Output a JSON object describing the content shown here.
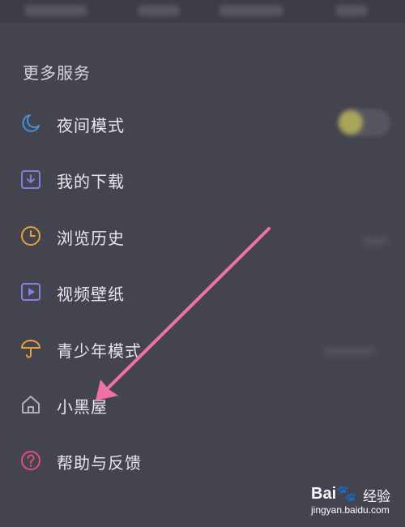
{
  "section": {
    "title": "更多服务"
  },
  "menu": [
    {
      "label": "夜间模式",
      "icon": "moon-icon",
      "color": "#4a8fd6"
    },
    {
      "label": "我的下载",
      "icon": "download-icon",
      "color": "#7f7fdc"
    },
    {
      "label": "浏览历史",
      "icon": "clock-icon",
      "color": "#e6a23c"
    },
    {
      "label": "视频壁纸",
      "icon": "video-wallpaper-icon",
      "color": "#8a7fe0"
    },
    {
      "label": "青少年模式",
      "icon": "umbrella-icon",
      "color": "#e6a23c"
    },
    {
      "label": "小黑屋",
      "icon": "house-icon",
      "color": "#b0b0b8"
    },
    {
      "label": "帮助与反馈",
      "icon": "question-icon",
      "color": "#e0507a"
    }
  ],
  "watermark": {
    "brand": "Bai",
    "brand_suffix": "du",
    "product": "经验",
    "url": "jingyan.baidu.com"
  },
  "colors": {
    "background": "#44444f",
    "arrow": "#f070a8"
  }
}
